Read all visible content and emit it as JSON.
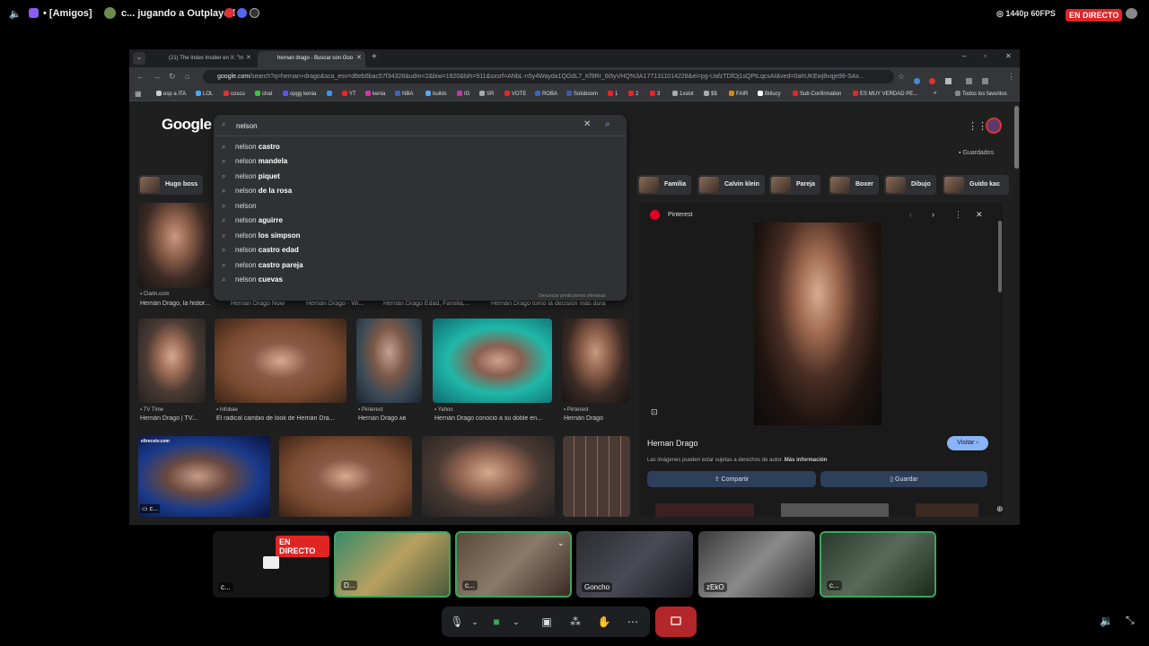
{
  "discord": {
    "server_tag": "• [Amigos]",
    "activity": "c... jugando a Outplayed",
    "stream_quality": "1440p 60FPS",
    "live_badge": "EN DIRECTO"
  },
  "browser": {
    "tabs": [
      {
        "label": "(21) The Index Insider en X: \"In"
      },
      {
        "label": "hernan drago - Buscar con Goo"
      }
    ],
    "url_host": "google.com",
    "url_rest": "/search?q=hernan+drago&sca_esv=d6eb6bac57f34328&udm=2&biw=1920&bih=911&sxsrf=ANbL-n5y4Wayda1QGdL7_Kf9Rr_6i5yVHQ%3A1771311014228&ei=pg-UafzTDfOj1sQPtLqcsAI&ved=0ahUKEwj8vqje99-SAx...",
    "bookmarks": [
      "esp a ITA",
      "LOL",
      "coscu",
      "chat",
      "opgg kenia",
      "YT",
      "kenia",
      "NBA",
      "builds",
      "IG",
      "SR",
      "VOTE",
      "ROBA",
      "Soloboom",
      "1",
      "2",
      "3",
      "1xslot",
      "$$",
      "FAIR",
      "Bitlucy",
      "Sub Confirmation",
      "ES MUY VERDAD PE..."
    ],
    "all_bookmarks": "Todos los favoritos"
  },
  "google": {
    "logo": "Google",
    "search_value": "nelson",
    "suggestions": [
      {
        "prefix": "nelson",
        "rest": " castro"
      },
      {
        "prefix": "nelson",
        "rest": " mandela"
      },
      {
        "prefix": "nelson",
        "rest": " piquet"
      },
      {
        "prefix": "nelson",
        "rest": " de la rosa"
      },
      {
        "prefix": "nelson",
        "rest": ""
      },
      {
        "prefix": "nelson",
        "rest": " aguirre"
      },
      {
        "prefix": "nelson",
        "rest": " los simpson"
      },
      {
        "prefix": "nelson",
        "rest": " castro edad"
      },
      {
        "prefix": "nelson",
        "rest": " castro pareja"
      },
      {
        "prefix": "nelson",
        "rest": " cuevas"
      }
    ],
    "report": "Denunciar predicciones ofensivas",
    "saved": "Guardados",
    "chips_left": [
      "Hugo boss"
    ],
    "chips_right": [
      "Familia",
      "Calvin klein",
      "Pareja",
      "Boxer",
      "Dibujo",
      "Guido kac"
    ],
    "row1": [
      {
        "source": "Clarin.com",
        "caption": "Hernán Drago, la histor..."
      },
      {
        "source": "",
        "caption": "Hernán Drago Now"
      },
      {
        "source": "",
        "caption": "Hernán Drago - Wi..."
      },
      {
        "source": "",
        "caption": "Hernán Drago Edad, Familia,..."
      },
      {
        "source": "",
        "caption": "Hernán Drago tomó la decisión más dura"
      }
    ],
    "row2": [
      {
        "source": "TV Time",
        "caption": "Hernán Drago | TV..."
      },
      {
        "source": "Infobae",
        "caption": "El radical cambio de look de Hernán Dra..."
      },
      {
        "source": "Pinterest",
        "caption": "Hernán Drago ᴀʙ"
      },
      {
        "source": "Yahoo",
        "caption": "Hernán Drago conoció a su doble en..."
      },
      {
        "source": "Pinterest",
        "caption": "Hernán Drago"
      }
    ],
    "row3_overlay": "c...",
    "row3_logo": "eltrecetv.com",
    "panel": {
      "source": "Pinterest",
      "title": "Hernan Drago",
      "visit": "Visitar",
      "copyright": "Las imágenes pueden estar sujetas a derechos de autor.",
      "more_info": "Más información",
      "share": "Compartir",
      "save": "Guardar"
    }
  },
  "call": {
    "live": "EN DIRECTO",
    "tiles": [
      {
        "name": "c..."
      },
      {
        "name": "D..."
      },
      {
        "name": "c..."
      },
      {
        "name": "Goncho"
      },
      {
        "name": "zEkO"
      },
      {
        "name": "c..."
      }
    ]
  },
  "colors": {
    "live": "#e02424",
    "speaking": "#3ba55d",
    "leave": "#b3262a"
  }
}
